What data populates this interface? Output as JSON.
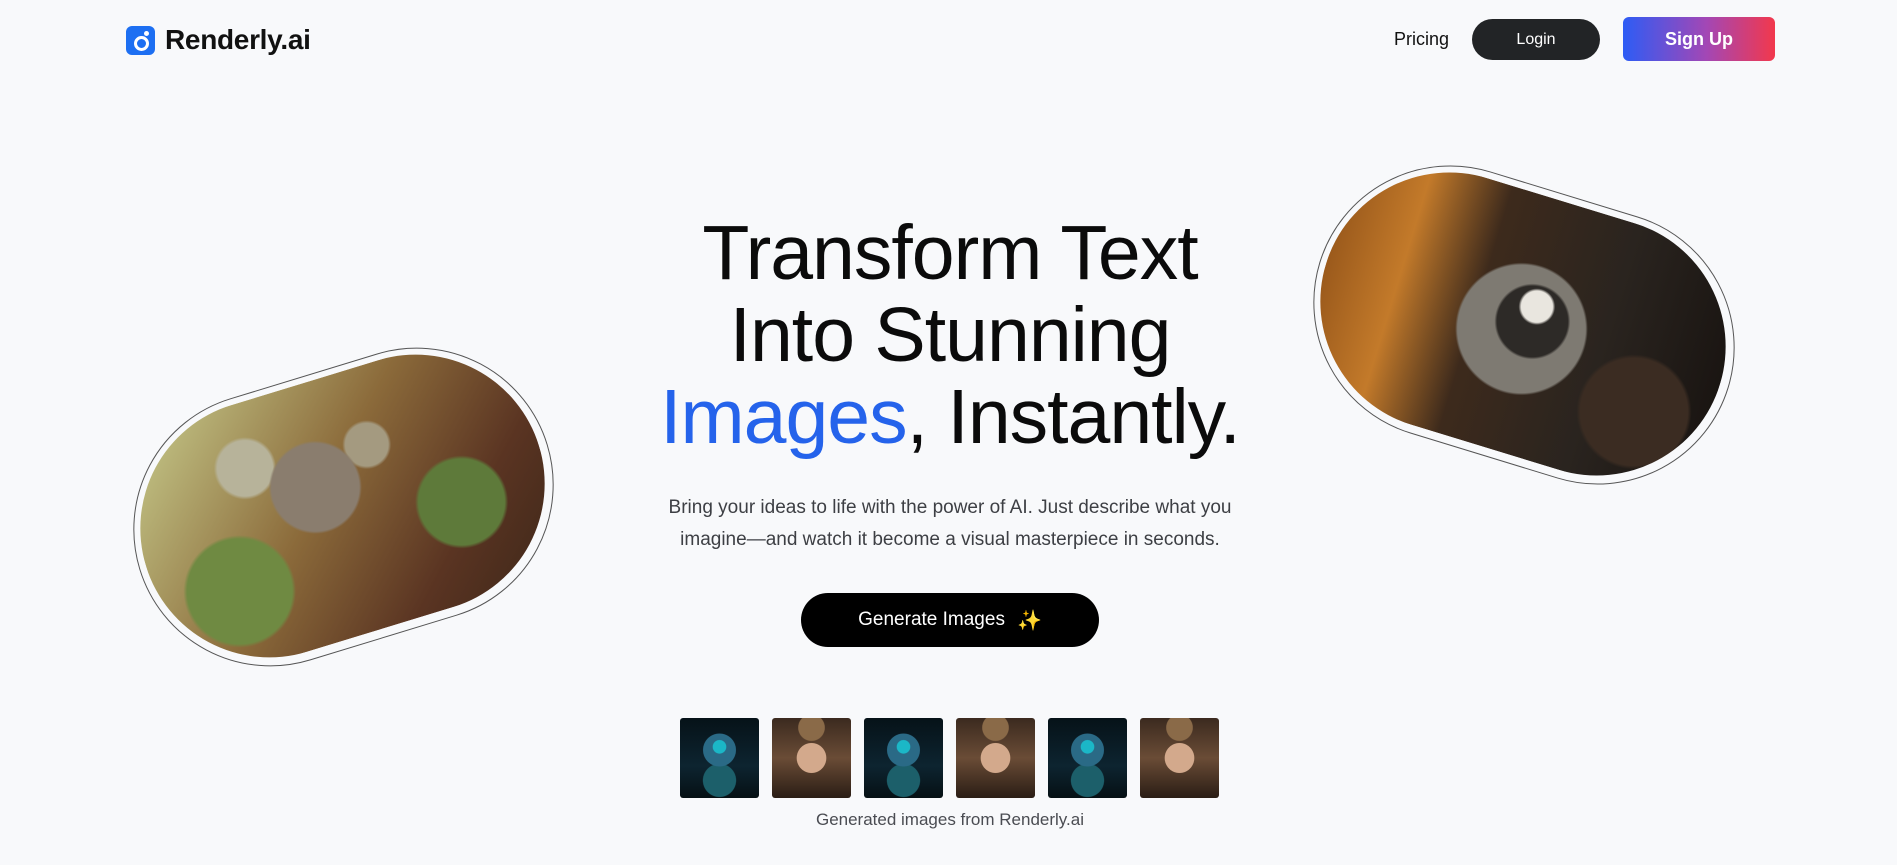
{
  "header": {
    "logo_text": "Renderly.ai",
    "nav_pricing": "Pricing",
    "login_label": "Login",
    "signup_label": "Sign Up"
  },
  "hero": {
    "title_line1": "Transform Text",
    "title_line2": "Into Stunning",
    "title_accent": "Images",
    "title_rest": ", Instantly.",
    "subtitle_line1": "Bring your ideas to life with the power of AI. Just describe what you",
    "subtitle_line2": "imagine—and watch it become a visual masterpiece in seconds.",
    "cta_label": "Generate Images",
    "cta_icon": "sparkles-icon",
    "cta_icon_glyph": "✨"
  },
  "showcase": {
    "left_image": "koala-image",
    "right_image": "raccoon-image"
  },
  "thumbnails": {
    "items": [
      "spider-robot-image",
      "woman-portrait-image",
      "spider-robot-image",
      "woman-portrait-image",
      "spider-robot-image",
      "woman-portrait-image"
    ],
    "caption": "Generated images from Renderly.ai"
  },
  "colors": {
    "accent": "#2563eb",
    "logo": "#1d6ff2",
    "signup_gradient_start": "#2d5cf5",
    "signup_gradient_end": "#f2384c",
    "background": "#f8f9fb"
  }
}
